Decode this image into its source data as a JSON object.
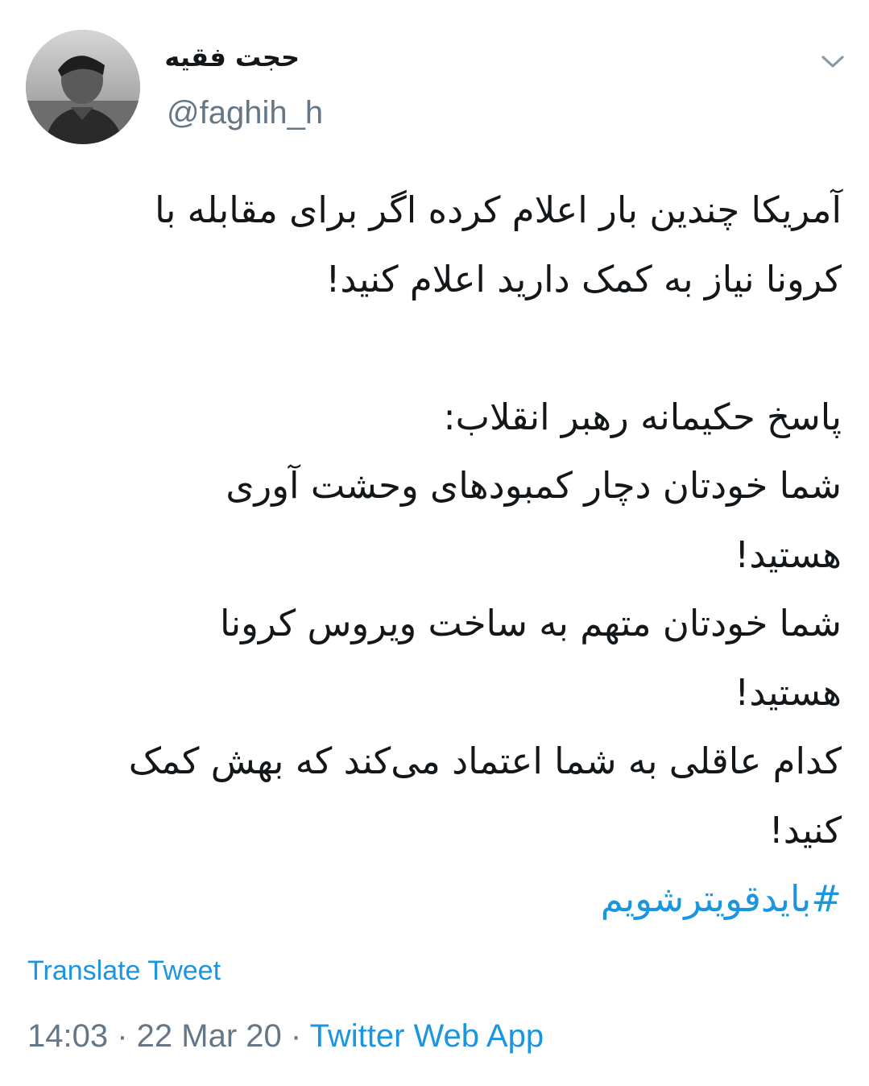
{
  "header": {
    "display_name": "حجت فقیه",
    "handle": "@faghih_h",
    "menu_icon": "chevron-down-icon",
    "avatar_icon": "profile-photo"
  },
  "tweet": {
    "lines": [
      "آمریکا چندین بار اعلام کرده اگر برای مقابله با",
      "کرونا نیاز به کمک دارید اعلام کنید!",
      "",
      "پاسخ حکیمانه رهبر انقلاب:",
      "شما خودتان دچار کمبودهای وحشت آوری",
      "هستید!",
      "شما خودتان متهم به ساخت ویروس کرونا",
      "هستید!",
      "کدام عاقلی به شما اعتماد می‌کند که بهش کمک",
      "کنید!"
    ],
    "hashtag": "#بایدقویترشویم"
  },
  "translate_label": "Translate Tweet",
  "meta": {
    "time": "14:03",
    "separator": " · ",
    "date": "22 Mar 20",
    "source": "Twitter Web App"
  },
  "colors": {
    "link": "#1b95e0",
    "secondary_text": "#657786",
    "primary_text": "#14171a"
  }
}
